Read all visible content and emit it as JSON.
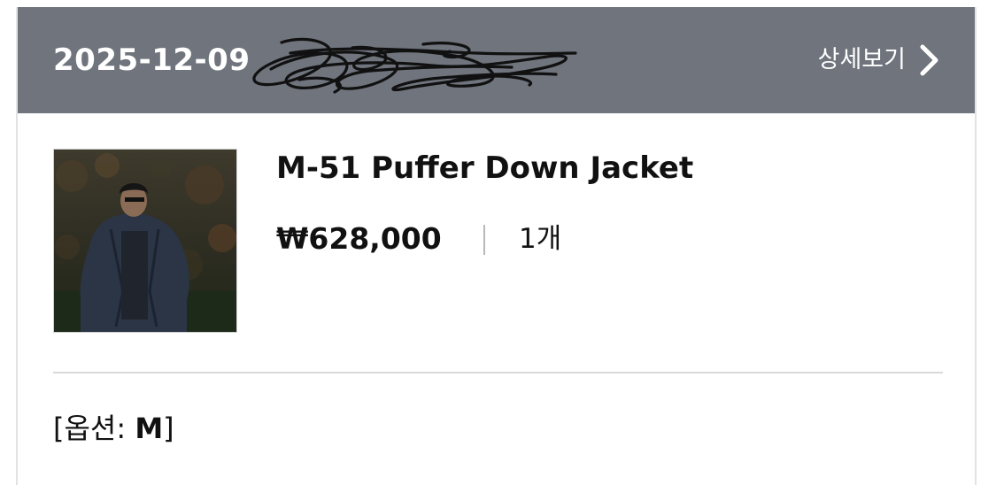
{
  "order": {
    "date": "2025-12-09",
    "detail_label": "상세보기",
    "detail_icon": "chevron-right-icon"
  },
  "product": {
    "image_icon": "product-photo",
    "name": "M-51 Puffer Down Jacket",
    "price": "₩628,000",
    "quantity": "1개",
    "option_prefix": "[옵션: ",
    "option_value": "M",
    "option_suffix": "]"
  },
  "colors": {
    "header_bg": "#6f747d",
    "header_text": "#ffffff",
    "body_text": "#111111",
    "divider": "#d9d9d9"
  }
}
